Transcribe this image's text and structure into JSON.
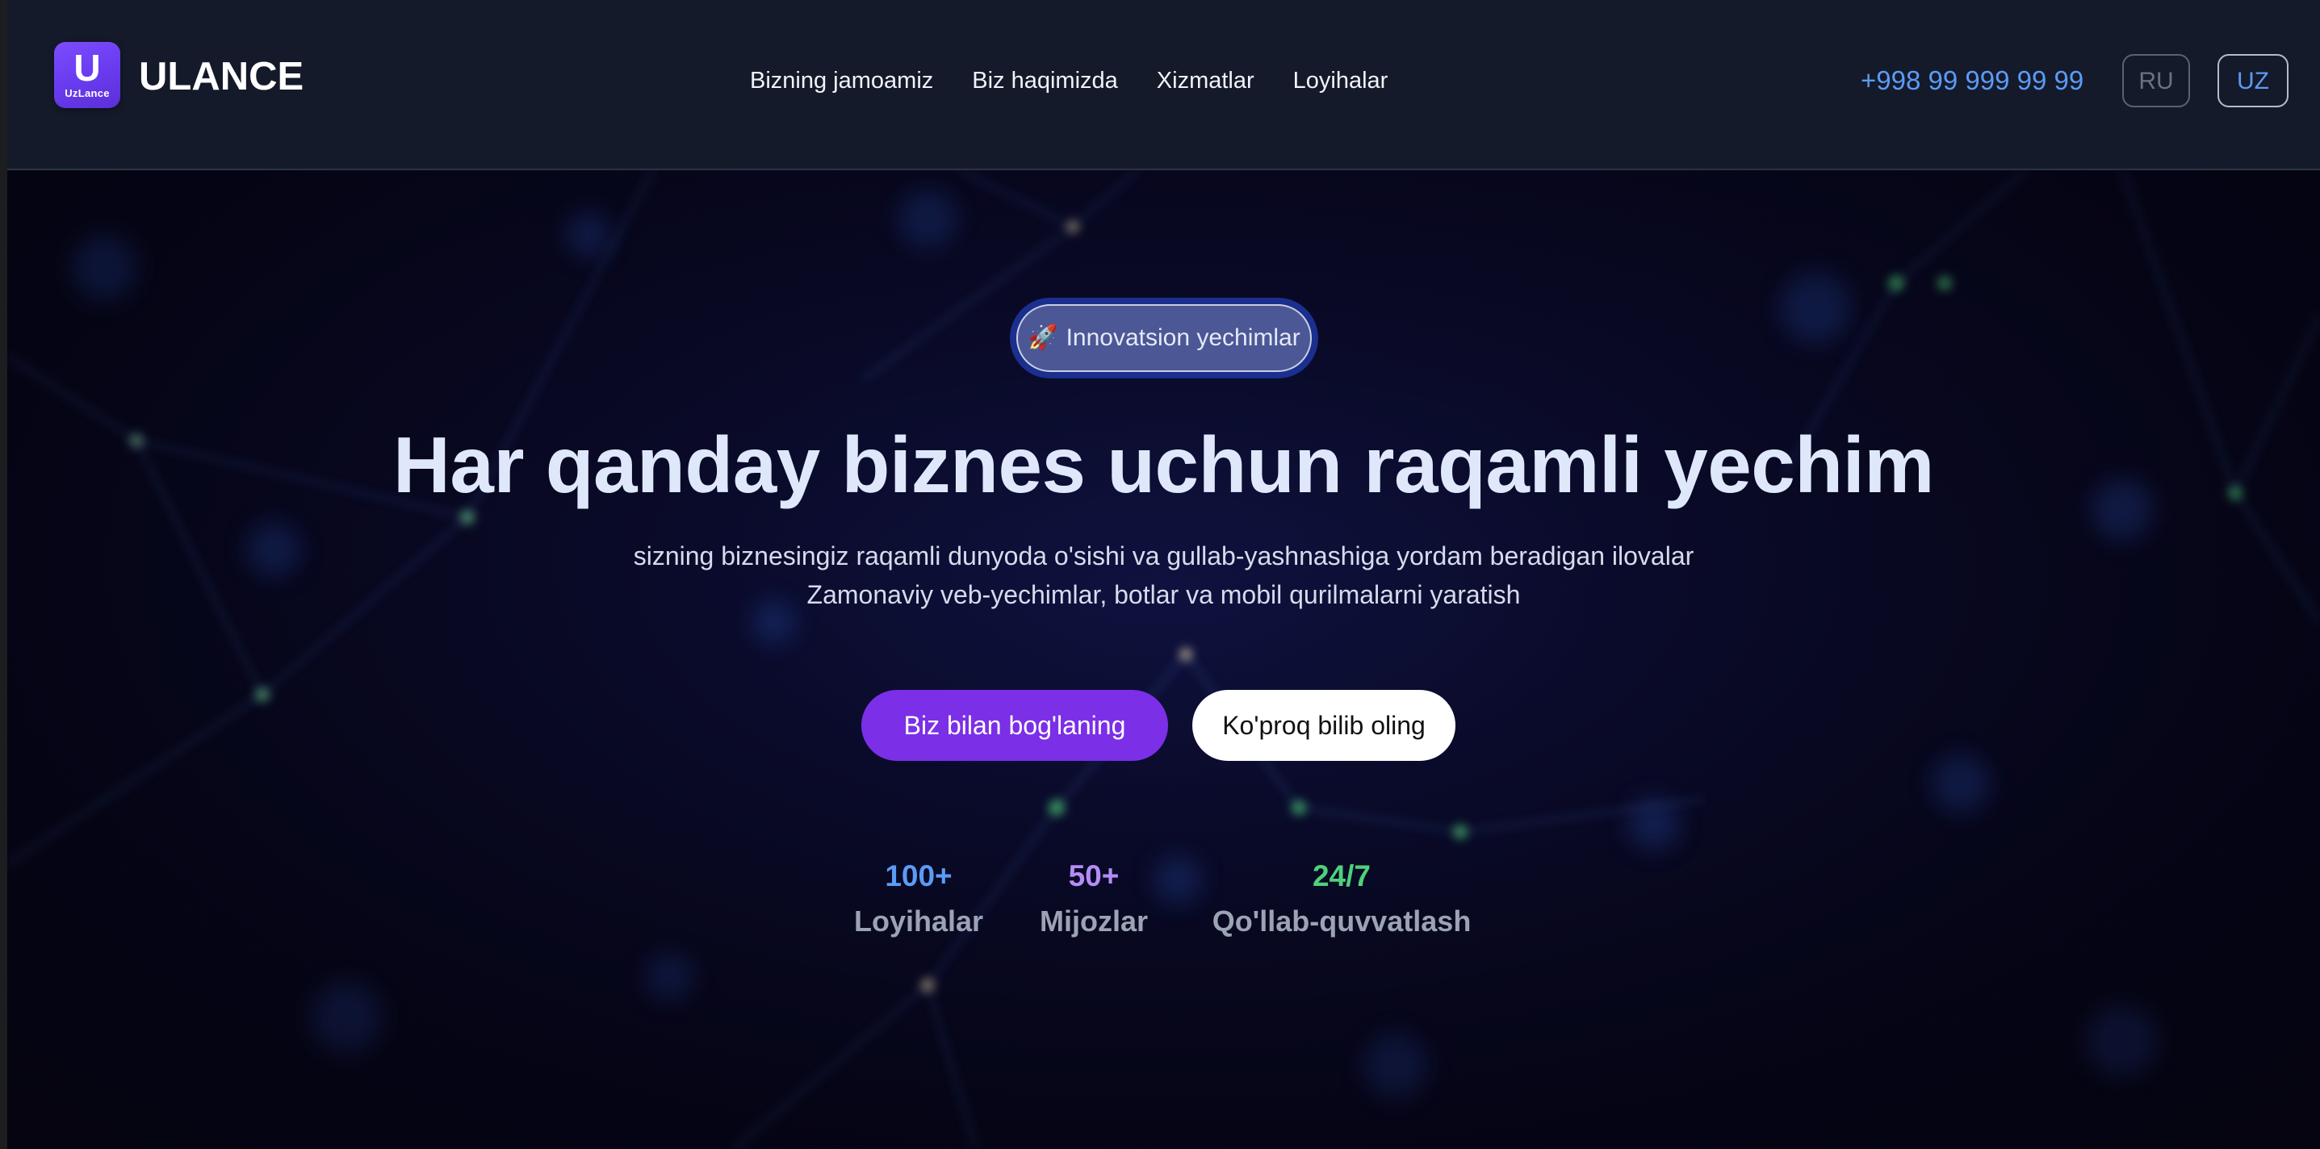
{
  "brand": {
    "logo_letter": "U",
    "logo_subtext": "UzLance",
    "name": "ULANCE"
  },
  "nav": {
    "items": [
      {
        "label": "Bizning jamoamiz"
      },
      {
        "label": "Biz haqimizda"
      },
      {
        "label": "Xizmatlar"
      },
      {
        "label": "Loyihalar"
      }
    ]
  },
  "header_right": {
    "phone": "+998 99 999 99 99",
    "lang_ru": "RU",
    "lang_uz": "UZ",
    "active_lang": "UZ"
  },
  "hero": {
    "badge_icon": "🚀",
    "badge_icon_name": "rocket-icon",
    "badge_text": "Innovatsion yechimlar",
    "headline": "Har qanday biznes uchun raqamli yechim",
    "subtitle_line1": "sizning biznesingiz raqamli dunyoda o'sishi va gullab-yashnashiga yordam beradigan ilovalar",
    "subtitle_line2": "Zamonaviy veb-yechimlar, botlar va mobil qurilmalarni yaratish",
    "primary_button": "Biz bilan bog'laning",
    "secondary_button": "Ko'proq bilib oling"
  },
  "stats": [
    {
      "value": "100+",
      "label": "Loyihalar",
      "color": "#5b9bf5"
    },
    {
      "value": "50+",
      "label": "Mijozlar",
      "color": "#b58cf7"
    },
    {
      "value": "24/7",
      "label": "Qo'llab-quvvatlash",
      "color": "#4fd07c"
    }
  ],
  "colors": {
    "header_bg": "#141a2a",
    "accent_purple": "#7b2fe6",
    "accent_blue": "#5b9bf5",
    "accent_green": "#4fd07c",
    "headline_text": "#dfe8fb"
  }
}
